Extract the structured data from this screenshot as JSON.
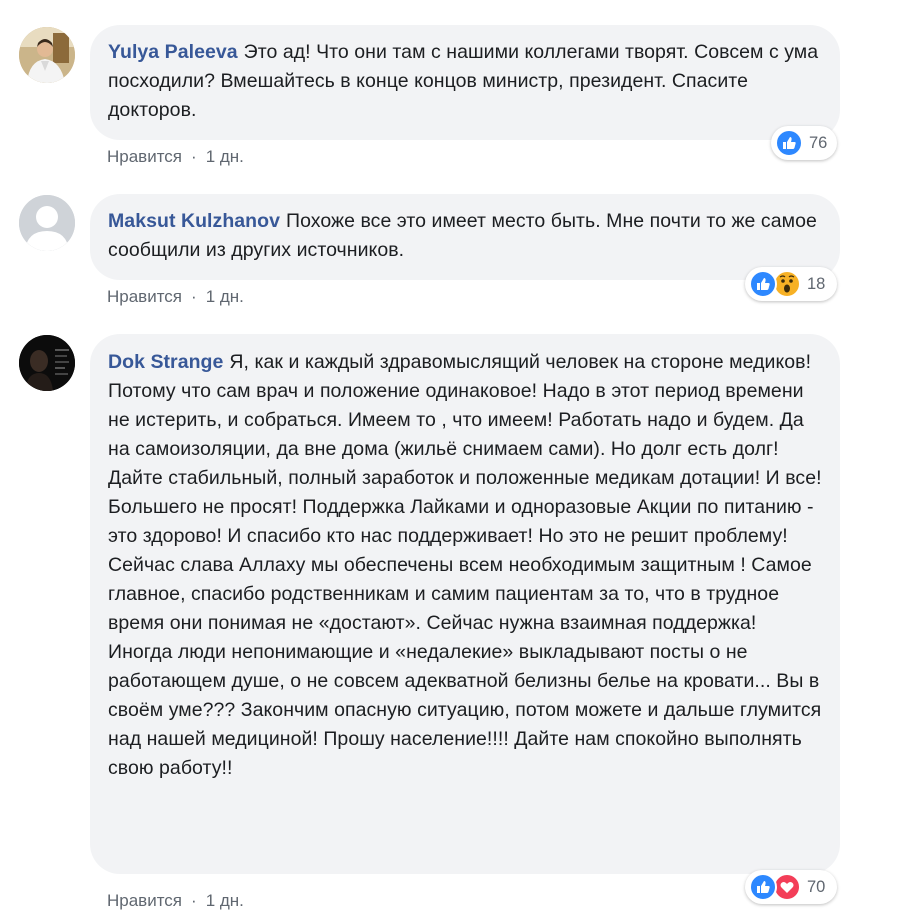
{
  "comments": [
    {
      "author": "Yulya Paleeva",
      "text": "Это ад! Что они там с нашими коллегами творят. Совсем с ума посходили? Вмешайтесь в конце концов министр, президент. Спасите докторов.",
      "like_label": "Нравится",
      "separator": "·",
      "time": "1 дн.",
      "reactions": [
        "like-icon"
      ],
      "reaction_count": "76",
      "avatar": "profile-photo-avatar"
    },
    {
      "author": "Maksut Kulzhanov",
      "text": "Похоже все это имеет место быть. Мне почти то же самое сообщили из других источников.",
      "like_label": "Нравится",
      "separator": "·",
      "time": "1 дн.",
      "reactions": [
        "like-icon",
        "wow-icon"
      ],
      "reaction_count": "18",
      "avatar": "default-avatar"
    },
    {
      "author": "Dok Strange",
      "text": "Я, как и каждый здравомыслящий человек на стороне медиков! Потому что сам врач и положение одинаковое! Надо в этот период времени не истерить, и собраться. Имеем то , что имеем! Работать надо и будем. Да на самоизоляции, да вне дома (жильё снимаем сами). Но долг есть долг! Дайте стабильный, полный заработок и положенные медикам дотации! И все! Большего не просят! Поддержка Лайками и одноразовые Акции по питанию - это здорово! И спасибо кто нас поддерживает! Но это не решит проблему! Сейчас слава Аллаху мы обеспечены всем необходимым защитным ! Самое главное, спасибо родственникам и самим пациентам за то, что в трудное время они понимая не «достают». Сейчас нужна взаимная поддержка! Иногда люди непонимающие и «недалекие» выкладывают посты о не работающем душе, о не совсем адекватной белизны белье на кровати... Вы в своём уме??? Закончим опасную ситуацию, потом можете и дальше глумится над нашей медициной! Прошу население!!!! Дайте нам спокойно выполнять свою работу!!",
      "like_label": "Нравится",
      "separator": "·",
      "time": "1 дн.",
      "reactions": [
        "like-icon",
        "love-icon"
      ],
      "reaction_count": "70",
      "avatar": "dark-photo-avatar"
    }
  ]
}
